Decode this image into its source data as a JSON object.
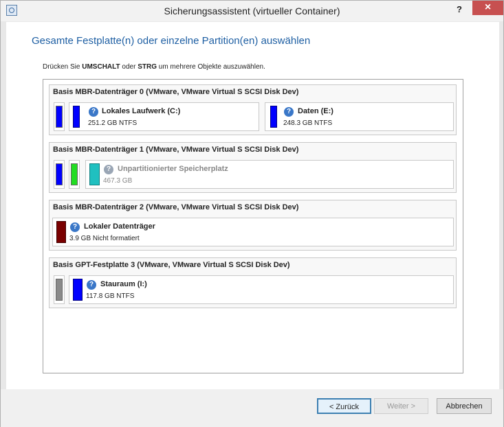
{
  "window": {
    "title": "Sicherungsassistent (virtueller Container)",
    "help_label": "?",
    "close_label": "×"
  },
  "heading": "Gesamte Festplatte(n) oder einzelne Partition(en) auswählen",
  "instruction": {
    "prefix": "Drücken Sie ",
    "key1": "UMSCHALT",
    "mid": " oder ",
    "key2": "STRG",
    "suffix": " um mehrere Objekte auszuwählen."
  },
  "disks": [
    {
      "title": "Basis MBR-Datenträger 0 (VMware, VMware Virtual S SCSI Disk Dev)",
      "partitions": [
        {
          "name": "Lokales Laufwerk (C:)",
          "size": "251.2 GB NTFS",
          "color": "#0000ff"
        },
        {
          "name": "Daten (E:)",
          "size": "248.3 GB NTFS",
          "color": "#0000ff"
        }
      ]
    },
    {
      "title": "Basis MBR-Datenträger 1 (VMware, VMware Virtual S SCSI Disk Dev)",
      "partitions": [
        {
          "name": "Unpartitionierter Speicherplatz",
          "size": "467.3 GB",
          "color": "#20c0c0"
        }
      ]
    },
    {
      "title": "Basis MBR-Datenträger 2 (VMware, VMware Virtual S SCSI Disk Dev)",
      "partitions": [
        {
          "name": "Lokaler Datenträger",
          "size": "3.9 GB Nicht formatiert",
          "color": "#7a0000"
        }
      ]
    },
    {
      "title": "Basis GPT-Festplatte 3 (VMware, VMware Virtual S SCSI Disk Dev)",
      "partitions": [
        {
          "name": "Stauraum (I:)",
          "size": "117.8 GB NTFS",
          "color": "#0000ff"
        }
      ]
    }
  ],
  "small_bar_colors": {
    "blue": "#0000ff",
    "green": "#22dd22",
    "gray": "#8a8a8a"
  },
  "buttons": {
    "back": "< Zurück",
    "next": "Weiter >",
    "cancel": "Abbrechen"
  }
}
